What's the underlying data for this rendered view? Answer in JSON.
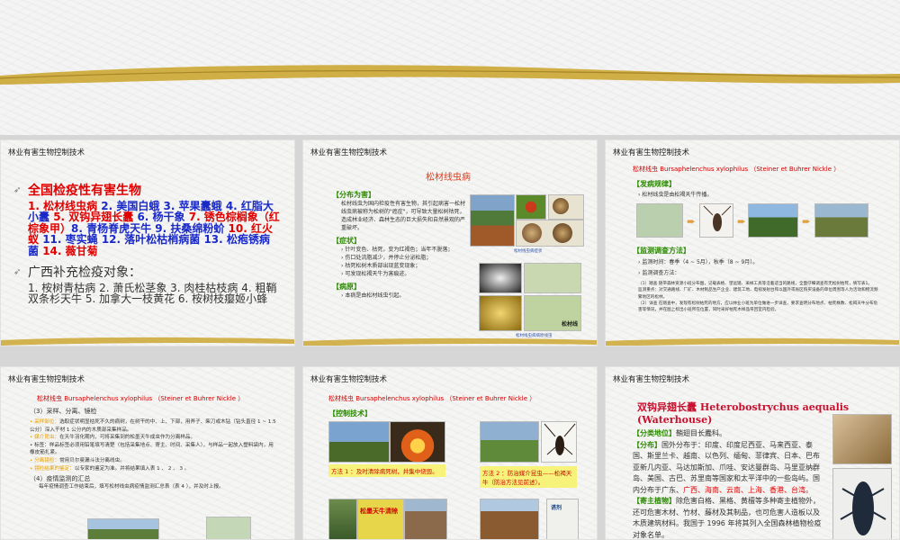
{
  "slide_header": "林业有害生物控制技术",
  "slide1": {
    "head1": "全国检疫性有害生物",
    "items": [
      {
        "text": "1. 松材线虫病",
        "style": "red"
      },
      {
        "text": " 2. 美国白蛾 ",
        "style": "blue"
      },
      {
        "text": "3. 苹果蠹蛾 ",
        "style": "blue"
      },
      {
        "text": "4. 红脂大小蠹 ",
        "style": "blue"
      },
      {
        "text": "5. 双钩异翅长蠹 ",
        "style": "red"
      },
      {
        "text": "6. 杨干象 ",
        "style": "blue"
      },
      {
        "text": "7. 锈色棕榈象（红棕象甲）",
        "style": "red"
      },
      {
        "text": "8. 青杨脊虎天牛 ",
        "style": "blue"
      },
      {
        "text": "9. 扶桑绵粉蚧 ",
        "style": "blue"
      },
      {
        "text": "10. 红火蚁 ",
        "style": "red"
      },
      {
        "text": "11. 枣实蝇 ",
        "style": "blue"
      },
      {
        "text": "12. 落叶松枯梢病菌 ",
        "style": "blue"
      },
      {
        "text": "13. 松疱锈病菌 ",
        "style": "blue"
      },
      {
        "text": "14. 薇甘菊",
        "style": "red"
      }
    ],
    "head2": "广西补充检疫对象：",
    "line2": "1. 桉树青枯病 2. 萧氏松茎象 3. 肉桂枯枝病 4. 粗鞘双条杉天牛 5. 加拿大一枝黄花 6. 桉树枝瘿姬小蜂"
  },
  "slide2": {
    "title": "松材线虫病",
    "sec1": "【分布为害】",
    "p1": "松材线虫为国内检疫性有害生物，其引起病害一松材线虫病被称为松树的\"癌症\"，可导致大量松树枯死，造成林业经济、森林生态的巨大损失和自然景观的严重破坏。",
    "sec2": "【症状】",
    "symptoms": [
      "针叶变色、枯死，变为红褐色；当年不脱落；",
      "伤口处流脂减少，并停止分泌松脂；",
      "枯死松树木质部出现蓝变现象；",
      "可发现松褐天牛为害痕迹。"
    ],
    "sec3": "【病原】",
    "p3": "本病是由松材线虫引起。",
    "cap1": "松材线虫病症状",
    "cap2": "松材线虫病病原线虫",
    "cap3": "松材线"
  },
  "slide3": {
    "title": "松材线虫  Bursaphelenchus xylophilus （Steiner et Buhrer Nickle ）",
    "sec1": "【发病规律】",
    "p1": "松材线虫是由松褐天牛传播。",
    "sec2": "【监测调查方法】",
    "b1": "监测时间：春季（4 ~ 5月），秋季（8 ~ 9月）。",
    "b2": "监测调查方法：",
    "p2": "（1）踏查  随带森林资源小班分布图，记载表格、望远镜、采样工具等沿着适当的路线，全面仔细调查有无松树枯死，填写表1。",
    "p3": "监测重点：对交通路线、厂矿、木材制品生产企业、建筑工地、电视发射台和以国外或省区购买设备的单位周围等人为活动和物流频繁地区的松林。",
    "p4": "（2）详查  在踏查中，发现有松树枯死的地方，应以林业小班为单位做进一步详查，要求查明分布地点、枯死株数、松褐天牛分布危害等情况，并在图上标出小班所在位置，同时采好枯死木样品带回室内检验。"
  },
  "slide4": {
    "title": "松材线虫  Bursaphelenchus xylophilus （Steiner et Buhrer Nickle ）",
    "sec1": "（3）采样、分离、镜检",
    "items": [
      {
        "label": "采样部位：",
        "text": "选取症状明显枯死不久的病树，在树干的中、上、下部，用斧子、柴刀或木钻（钻头直径 1 ~ 1.5 公分）深入干材 1 公分内的木质部采集样品。"
      },
      {
        "label": "媒介昆虫：",
        "text": "在天牛羽化期内，可将采集到的松墨天牛成虫作为分离样品。"
      },
      {
        "label": "标签：",
        "text": "样品标签必须用铅笔填写清楚（包括采集地点、寄主、时间、采集人），与样品一起放入塑料袋内，用橡皮筋扎紧。"
      },
      {
        "label": "分离镜检：",
        "text": "常用贝尔曼漏斗法分离线虫。"
      },
      {
        "label": "镜检结果的鉴定：",
        "text": "以专家的鉴定为准。并将结果填入表 1 、 2 、 3 。"
      }
    ],
    "sec2": "（4）疫情监测的汇总",
    "p2": "每年疫情调查工作结束后，填写松材线虫病疫情监测汇总表（表 4 ），并及时上报。"
  },
  "slide5": {
    "title": "松材线虫  Bursaphelenchus xylophilus （Steiner et Buhrer Nickle ）",
    "sec1": "【控制技术】",
    "m1": "方法 1 ：及时清除病死树，并集中烧毁。",
    "m2": "方法 2 ：防治媒介昆虫——松褐天牛（防治方法见前述）。",
    "sign": "松墨天牛清除",
    "sign2": "诱剂"
  },
  "slide6": {
    "title": "双钩异翅长蠹 Heterobostrychus aequalis (Waterhouse)",
    "lines": [
      {
        "label": "【分类地位】",
        "text": "鞘翅目长蠹科。"
      },
      {
        "label": "【分布】",
        "text": "国外分布于：印度、印度尼西亚、马来西亚、泰国、斯里兰卡、越南、以色列、缅甸、菲律宾、日本、巴布亚新几内亚、马达加斯加、爪哇、安达曼群岛、马里亚纳群岛、美国、古巴、苏里南等国家和太平洋中的一些岛屿。国内分布于广东、"
      },
      {
        "label": "",
        "text": "广西、海南、云南、上海、香港、台湾。"
      },
      {
        "label": "【寄主植物】",
        "text": "除危害白格、黑格、黄檀等多种寄主植物外，还可危害木材、竹材、藤材及其制品，也可危害人造板以及木质建筑材料。我国于 1996 年将其列入全国森林植物检疫对象名单。"
      }
    ]
  },
  "colors": {
    "accent_red": "#e00000",
    "accent_blue": "#1a2ac8",
    "section_green": "#2a8a00",
    "gold": "#c9a227"
  }
}
